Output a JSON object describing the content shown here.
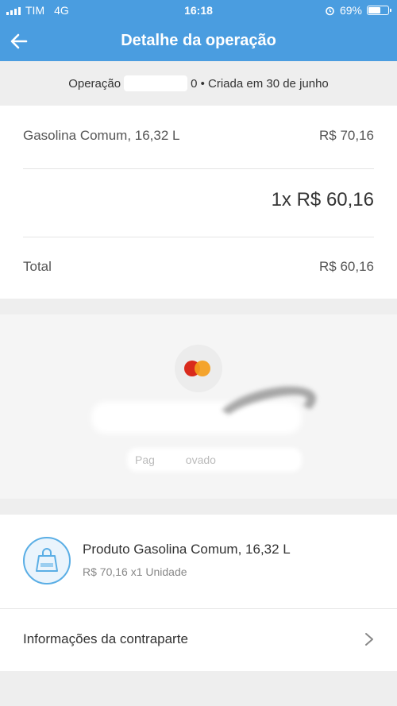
{
  "status_bar": {
    "carrier": "TIM",
    "network": "4G",
    "time": "16:18",
    "battery": "69%",
    "battery_level": 0.69
  },
  "header": {
    "title": "Detalhe da operação"
  },
  "operation": {
    "prefix": "Operação",
    "suffix": "0 • Criada em 30 de junho"
  },
  "summary": {
    "item_label": "Gasolina Comum, 16,32 L",
    "item_price": "R$ 70,16",
    "installments": "1x R$ 60,16",
    "total_label": "Total",
    "total_value": "R$ 60,16"
  },
  "payment": {
    "card_brand_icon": "mastercard-icon",
    "status_partial": "Pag          ovado"
  },
  "product": {
    "title": "Produto Gasolina Comum, 16,32 L",
    "detail": "R$ 70,16 x1 Unidade"
  },
  "counterpart": {
    "label": "Informações da contraparte"
  }
}
